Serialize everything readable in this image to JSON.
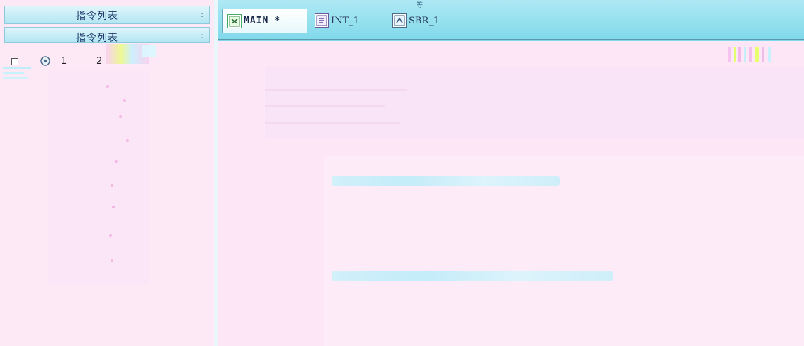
{
  "colors": {
    "background": "#fde8f6",
    "tabbar": "#8fdcec",
    "panel_header": "#c4ecf6",
    "accent_text": "#1a2a4a"
  },
  "left_panel": {
    "header_title": "指令列表",
    "header_title_2": "指令列表",
    "pin_glyph": ":",
    "tree": {
      "item_number": "1",
      "item_number_2": "2"
    }
  },
  "tabs": [
    {
      "label": "MAIN",
      "modified_marker": "*",
      "icon": "program-block-icon"
    },
    {
      "label": "INT_1",
      "icon": "interrupt-block-icon"
    },
    {
      "label": "SBR_1",
      "icon": "subroutine-block-icon"
    }
  ],
  "small_tag": "等"
}
